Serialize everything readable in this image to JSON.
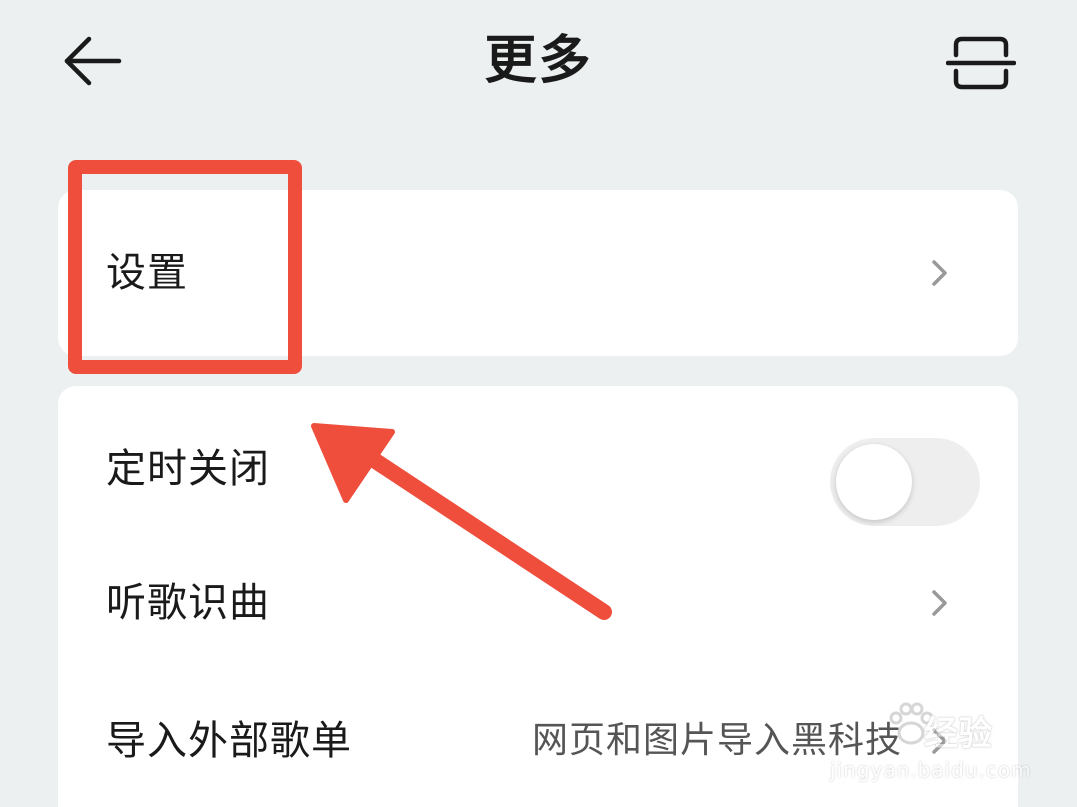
{
  "header": {
    "title": "更多",
    "back_icon": "arrow-left-icon",
    "scan_icon": "scan-icon"
  },
  "settings_card": {
    "label": "设置"
  },
  "list": {
    "items": [
      {
        "label": "定时关闭",
        "type": "toggle",
        "toggle_on": false
      },
      {
        "label": "听歌识曲",
        "type": "link"
      },
      {
        "label": "导入外部歌单",
        "type": "link",
        "value": "网页和图片导入黑科技"
      }
    ]
  },
  "colors": {
    "background": "#ecf0f1",
    "card": "#ffffff",
    "annotation": "#ee4e3b",
    "text": "#1a1a1a"
  },
  "watermark": {
    "brand": "经验",
    "url": "jingyan.baidu.com"
  }
}
